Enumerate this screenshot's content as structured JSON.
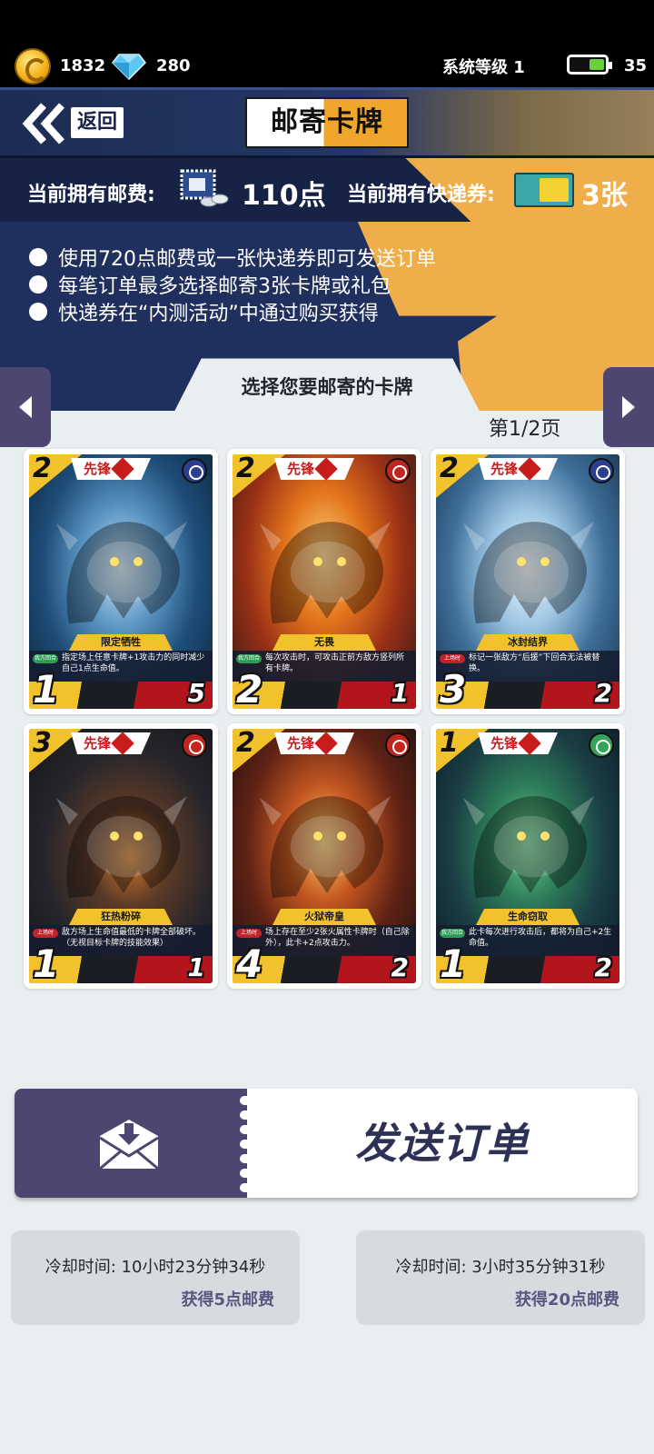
{
  "status": {
    "coins": "1832",
    "gems": "280",
    "system_level": "系统等级 1",
    "battery": "35"
  },
  "header": {
    "back_label": "返回",
    "title": "邮寄卡牌"
  },
  "wallet": {
    "fee_label": "当前拥有邮费:",
    "fee_value": "110点",
    "ticket_label": "当前拥有快递券:",
    "ticket_value": "3张"
  },
  "rules": [
    "使用720点邮费或一张快递券即可发送订单",
    "每笔订单最多选择邮寄3张卡牌或礼包",
    "快递券在“内测活动”中通过购买获得"
  ],
  "panel": {
    "title": "选择您要邮寄的卡牌",
    "page": "第1/2页"
  },
  "cards": [
    {
      "cost": "2",
      "type": "先锋",
      "name": "限定牺牲",
      "tag": "我方回合",
      "desc": "指定场上任意卡牌+1攻击力的同时减少自己1点生命值。",
      "atk": "1",
      "hp": "5",
      "element": "ice-icon",
      "art": "ice"
    },
    {
      "cost": "2",
      "type": "先锋",
      "name": "无畏",
      "tag": "我方回合",
      "desc": "每次攻击时，可攻击正前方敌方竖列所有卡牌。",
      "atk": "2",
      "hp": "1",
      "element": "fire-icon",
      "art": "fire"
    },
    {
      "cost": "2",
      "type": "先锋",
      "name": "冰封结界",
      "tag": "上场时",
      "desc": "标记一张敌方“后援”下回合无法被替换。",
      "atk": "3",
      "hp": "2",
      "element": "ice-icon",
      "art": "frost"
    },
    {
      "cost": "3",
      "type": "先锋",
      "name": "狂热粉碎",
      "tag": "上场时",
      "desc": "敌方场上生命值最低的卡牌全部破坏。（无视目标卡牌的技能效果）",
      "atk": "1",
      "hp": "1",
      "element": "fire-icon",
      "art": "dark"
    },
    {
      "cost": "2",
      "type": "先锋",
      "name": "火狱帝皇",
      "tag": "上场时",
      "desc": "场上存在至少2张火属性卡牌时（自己除外），此卡+2点攻击力。",
      "atk": "4",
      "hp": "2",
      "element": "fire-icon",
      "art": "inferno"
    },
    {
      "cost": "1",
      "type": "先锋",
      "name": "生命窃取",
      "tag": "我方回合",
      "desc": "此卡每次进行攻击后，都将为自己+2生命值。",
      "atk": "1",
      "hp": "2",
      "element": "nature-icon",
      "art": "life"
    }
  ],
  "send": {
    "label": "发送订单"
  },
  "cooldowns": [
    {
      "time": "冷却时间: 10小时23分钟34秒",
      "reward": "获得5点邮费"
    },
    {
      "time": "冷却时间: 3小时35分钟31秒",
      "reward": "获得20点邮费"
    }
  ],
  "colors": {
    "accent_purple": "#4c4671",
    "navy": "#20305e",
    "orange": "#f0ae4b",
    "card_yellow": "#f2c22c",
    "card_red": "#b3151c"
  }
}
